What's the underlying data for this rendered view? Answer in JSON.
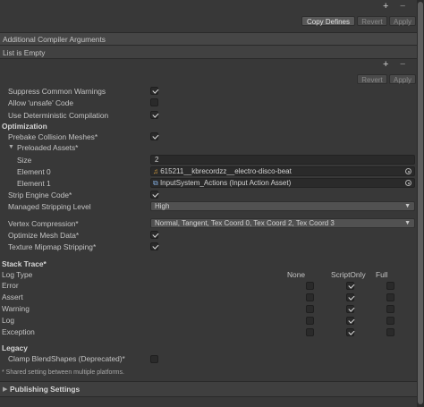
{
  "top_toolbar": {
    "plus": "+",
    "minus": "−",
    "copy_defines": "Copy Defines",
    "revert": "Revert",
    "apply": "Apply"
  },
  "compiler_args": {
    "header": "Additional Compiler Arguments",
    "empty": "List is Empty",
    "plus": "+",
    "minus": "−",
    "revert": "Revert",
    "apply": "Apply"
  },
  "toggles": {
    "suppress_warnings": {
      "label": "Suppress Common Warnings",
      "checked": true
    },
    "allow_unsafe": {
      "label": "Allow 'unsafe' Code",
      "checked": false
    },
    "deterministic": {
      "label": "Use Deterministic Compilation",
      "checked": true
    }
  },
  "optimization": {
    "header": "Optimization",
    "prebake": {
      "label": "Prebake Collision Meshes*",
      "checked": true
    },
    "preloaded": {
      "label": "Preloaded Assets*",
      "size_label": "Size",
      "size_value": "2",
      "elements": [
        {
          "label": "Element 0",
          "value": "615211__kbrecordzz__electro-disco-beat",
          "icon": "audio-icon"
        },
        {
          "label": "Element 1",
          "value": "InputSystem_Actions (Input Action Asset)",
          "icon": "input-actions-icon"
        }
      ]
    },
    "strip_engine": {
      "label": "Strip Engine Code*",
      "checked": true
    },
    "managed_stripping": {
      "label": "Managed Stripping Level",
      "value": "High"
    },
    "vertex_compression": {
      "label": "Vertex Compression*",
      "value": "Normal, Tangent, Tex Coord 0, Tex Coord 2, Tex Coord 3"
    },
    "optimize_mesh": {
      "label": "Optimize Mesh Data*",
      "checked": true
    },
    "texture_mipmap": {
      "label": "Texture Mipmap Stripping*",
      "checked": true
    }
  },
  "stack_trace": {
    "header": "Stack Trace*",
    "col_log_type": "Log Type",
    "columns": [
      "None",
      "ScriptOnly",
      "Full"
    ],
    "rows": [
      {
        "label": "Error",
        "values": [
          false,
          true,
          false
        ]
      },
      {
        "label": "Assert",
        "values": [
          false,
          true,
          false
        ]
      },
      {
        "label": "Warning",
        "values": [
          false,
          true,
          false
        ]
      },
      {
        "label": "Log",
        "values": [
          false,
          true,
          false
        ]
      },
      {
        "label": "Exception",
        "values": [
          false,
          true,
          false
        ]
      }
    ]
  },
  "legacy": {
    "header": "Legacy",
    "clamp": {
      "label": "Clamp BlendShapes (Deprecated)*",
      "checked": false
    }
  },
  "footnote": "* Shared setting between multiple platforms.",
  "publishing": {
    "label": "Publishing Settings"
  }
}
